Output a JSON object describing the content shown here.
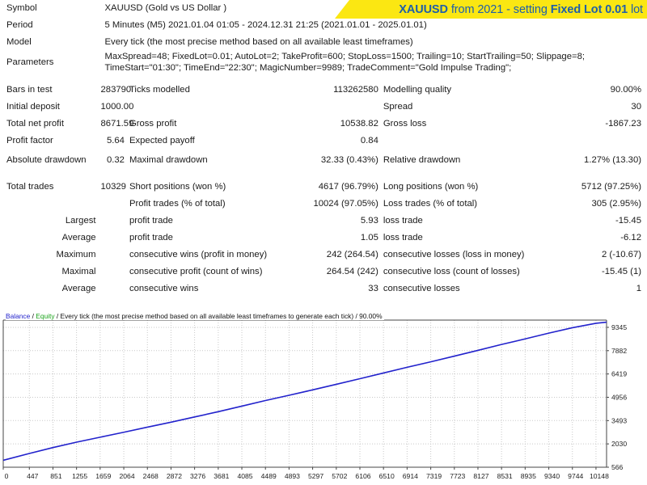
{
  "banner": {
    "segments": [
      {
        "text": "XAUUSD",
        "bold": true
      },
      {
        "text": " from 2021 - setting ",
        "bold": false
      },
      {
        "text": "Fixed Lot 0.01",
        "bold": true
      },
      {
        "text": " lot",
        "bold": false
      }
    ],
    "full_text": "XAUUSD from 2021 - setting Fixed Lot 0.01 lot",
    "bg_color": "#fbe712",
    "text_color": "#1f5fa9"
  },
  "header": {
    "symbol_label": "Symbol",
    "symbol_value": "XAUUSD (Gold vs US Dollar )",
    "period_label": "Period",
    "period_value": "5 Minutes (M5) 2021.01.04 01:05 - 2024.12.31 21:25 (2021.01.01 - 2025.01.01)",
    "model_label": "Model",
    "model_value": "Every tick (the most precise method based on all available least timeframes)",
    "parameters_label": "Parameters",
    "parameters_value": "MaxSpread=48; FixedLot=0.01; AutoLot=2; TakeProfit=600; StopLoss=1500; Trailing=10; StartTrailing=50; Slippage=8; TimeStart=\"01:30\"; TimeEnd=\"22:30\"; MagicNumber=9989; TradeComment=\"Gold Impulse Trading\";"
  },
  "stats": {
    "bars_in_test_label": "Bars in test",
    "bars_in_test_value": "283790",
    "ticks_modelled_label": "Ticks modelled",
    "ticks_modelled_value": "113262580",
    "modelling_quality_label": "Modelling quality",
    "modelling_quality_value": "90.00%",
    "initial_deposit_label": "Initial deposit",
    "initial_deposit_value": "1000.00",
    "spread_label": "Spread",
    "spread_value": "30",
    "total_net_profit_label": "Total net profit",
    "total_net_profit_value": "8671.59",
    "gross_profit_label": "Gross profit",
    "gross_profit_value": "10538.82",
    "gross_loss_label": "Gross loss",
    "gross_loss_value": "-1867.23",
    "profit_factor_label": "Profit factor",
    "profit_factor_value": "5.64",
    "expected_payoff_label": "Expected payoff",
    "expected_payoff_value": "0.84",
    "absolute_drawdown_label": "Absolute drawdown",
    "absolute_drawdown_value": "0.32",
    "maximal_drawdown_label": "Maximal drawdown",
    "maximal_drawdown_value": "32.33 (0.43%)",
    "relative_drawdown_label": "Relative drawdown",
    "relative_drawdown_value": "1.27% (13.30)"
  },
  "trades": {
    "total_trades_label": "Total trades",
    "total_trades_value": "10329",
    "short_positions_label": "Short positions (won %)",
    "short_positions_value": "4617 (96.79%)",
    "long_positions_label": "Long positions (won %)",
    "long_positions_value": "5712 (97.25%)",
    "profit_trades_label": "Profit trades (% of total)",
    "profit_trades_value": "10024 (97.05%)",
    "loss_trades_label": "Loss trades (% of total)",
    "loss_trades_value": "305 (2.95%)",
    "largest_label": "Largest",
    "largest_profit_trade_label": "profit trade",
    "largest_profit_trade_value": "5.93",
    "largest_loss_trade_label": "loss trade",
    "largest_loss_trade_value": "-15.45",
    "average_label": "Average",
    "average_profit_trade_label": "profit trade",
    "average_profit_trade_value": "1.05",
    "average_loss_trade_label": "loss trade",
    "average_loss_trade_value": "-6.12",
    "maximum_label": "Maximum",
    "max_consecutive_wins_label": "consecutive wins (profit in money)",
    "max_consecutive_wins_value": "242 (264.54)",
    "max_consecutive_losses_label": "consecutive losses (loss in money)",
    "max_consecutive_losses_value": "2 (-10.67)",
    "maximal_label": "Maximal",
    "maximal_consecutive_profit_label": "consecutive profit (count of wins)",
    "maximal_consecutive_profit_value": "264.54 (242)",
    "maximal_consecutive_loss_label": "consecutive loss (count of losses)",
    "maximal_consecutive_loss_value": "-15.45 (1)",
    "average2_label": "Average",
    "avg_consecutive_wins_label": "consecutive wins",
    "avg_consecutive_wins_value": "33",
    "avg_consecutive_losses_label": "consecutive losses",
    "avg_consecutive_losses_value": "1"
  },
  "chart_legend": {
    "balance": "Balance",
    "sep1": " / ",
    "equity": "Equity",
    "rest": " / Every tick (the most precise method based on all available least timeframes to generate each tick) / 90.00%",
    "balance_color": "#2222cc",
    "equity_color": "#19a319"
  },
  "chart_data": {
    "type": "line",
    "title": "Balance / Equity / Every tick (the most precise method based on all available least timeframes to generate each tick) / 90.00%",
    "xlabel": "",
    "ylabel": "",
    "series": [
      {
        "name": "Balance",
        "color": "#2222cc",
        "x": [
          0,
          447,
          851,
          1255,
          1659,
          2064,
          2468,
          2872,
          3276,
          3681,
          4085,
          4489,
          4893,
          5297,
          5702,
          6106,
          6510,
          6914,
          7319,
          7723,
          8127,
          8531,
          8935,
          9340,
          9744,
          10148,
          10329
        ],
        "values": [
          1000,
          1430,
          1800,
          2140,
          2450,
          2760,
          3080,
          3390,
          3720,
          4050,
          4400,
          4750,
          5080,
          5420,
          5770,
          6120,
          6480,
          6840,
          7180,
          7540,
          7900,
          8270,
          8620,
          8980,
          9320,
          9600,
          9672
        ]
      }
    ],
    "xticks": [
      0,
      447,
      851,
      1255,
      1659,
      2064,
      2468,
      2872,
      3276,
      3681,
      4085,
      4489,
      4893,
      5297,
      5702,
      6106,
      6510,
      6914,
      7319,
      7723,
      8127,
      8531,
      8935,
      9340,
      9744,
      10148
    ],
    "yticks": [
      566,
      2030,
      3493,
      4956,
      6419,
      7882,
      9345
    ],
    "xlim": [
      0,
      10329
    ],
    "ylim": [
      566,
      9800
    ],
    "grid": true,
    "legend_position": "top-left"
  }
}
